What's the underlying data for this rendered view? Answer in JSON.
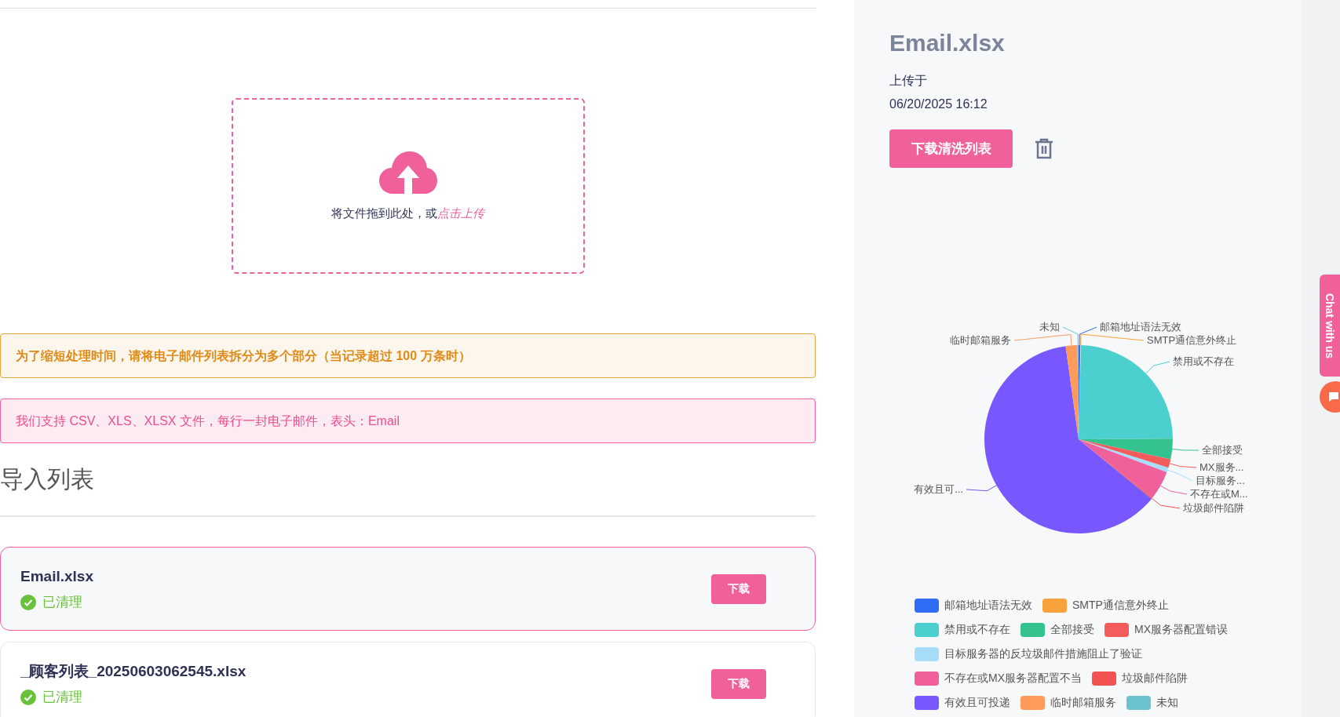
{
  "upload": {
    "prompt": "将文件拖到此处，或",
    "link": "点击上传"
  },
  "notices": [
    {
      "kind": "warning",
      "text": "为了缩短处理时间，请将电子邮件列表拆分为多个部分（当记录超过 100 万条时）"
    },
    {
      "kind": "info",
      "text": "我们支持 CSV、XLS、XLSX 文件，每行一封电子邮件，表头：Email"
    }
  ],
  "list_title": "导入列表",
  "files": [
    {
      "name": "Email.xlsx",
      "status": "已清理",
      "selected": true,
      "button": "下载"
    },
    {
      "name": "_顾客列表_20250603062545.xlsx",
      "status": "已清理",
      "selected": false,
      "button": "下载"
    }
  ],
  "detail": {
    "title": "Email.xlsx",
    "uploaded_label": "上传于",
    "uploaded_at": "06/20/2025 16:12",
    "download_button": "下载清洗列表"
  },
  "legend_rows": [
    [
      {
        "name": "邮箱地址语法无效",
        "color": "#2f6df6",
        "slice_label": "邮箱地址语法无效"
      },
      {
        "name": "SMTP通信意外终止",
        "color": "#f9a23c",
        "slice_label": "SMTP通信意外终止"
      }
    ],
    [
      {
        "name": "禁用或不存在",
        "color": "#4ccfcf",
        "slice_label": "禁用或不存在"
      },
      {
        "name": "全部接受",
        "color": "#34c38f",
        "slice_label": "全部接受"
      },
      {
        "name": "MX服务器配置错误",
        "color": "#f45b5b",
        "slice_label": "MX服务..."
      }
    ],
    [
      {
        "name": "目标服务器的反垃圾邮件措施阻止了验证",
        "color": "#a8dcfb",
        "slice_label": "目标服务..."
      }
    ],
    [
      {
        "name": "不存在或MX服务器配置不当",
        "color": "#f0609a",
        "slice_label": "不存在或M..."
      },
      {
        "name": "垃圾邮件陷阱",
        "color": "#f25252",
        "slice_label": "垃圾邮件陷阱"
      }
    ],
    [
      {
        "name": "有效且可投递",
        "color": "#7857ff",
        "slice_label": "有效且可..."
      },
      {
        "name": "临时邮箱服务",
        "color": "#ff9b5a",
        "slice_label": "临时邮箱服务"
      },
      {
        "name": "未知",
        "color": "#6cc3cf",
        "slice_label": "未知"
      }
    ]
  ],
  "chat": {
    "label": "Chat with us"
  }
}
